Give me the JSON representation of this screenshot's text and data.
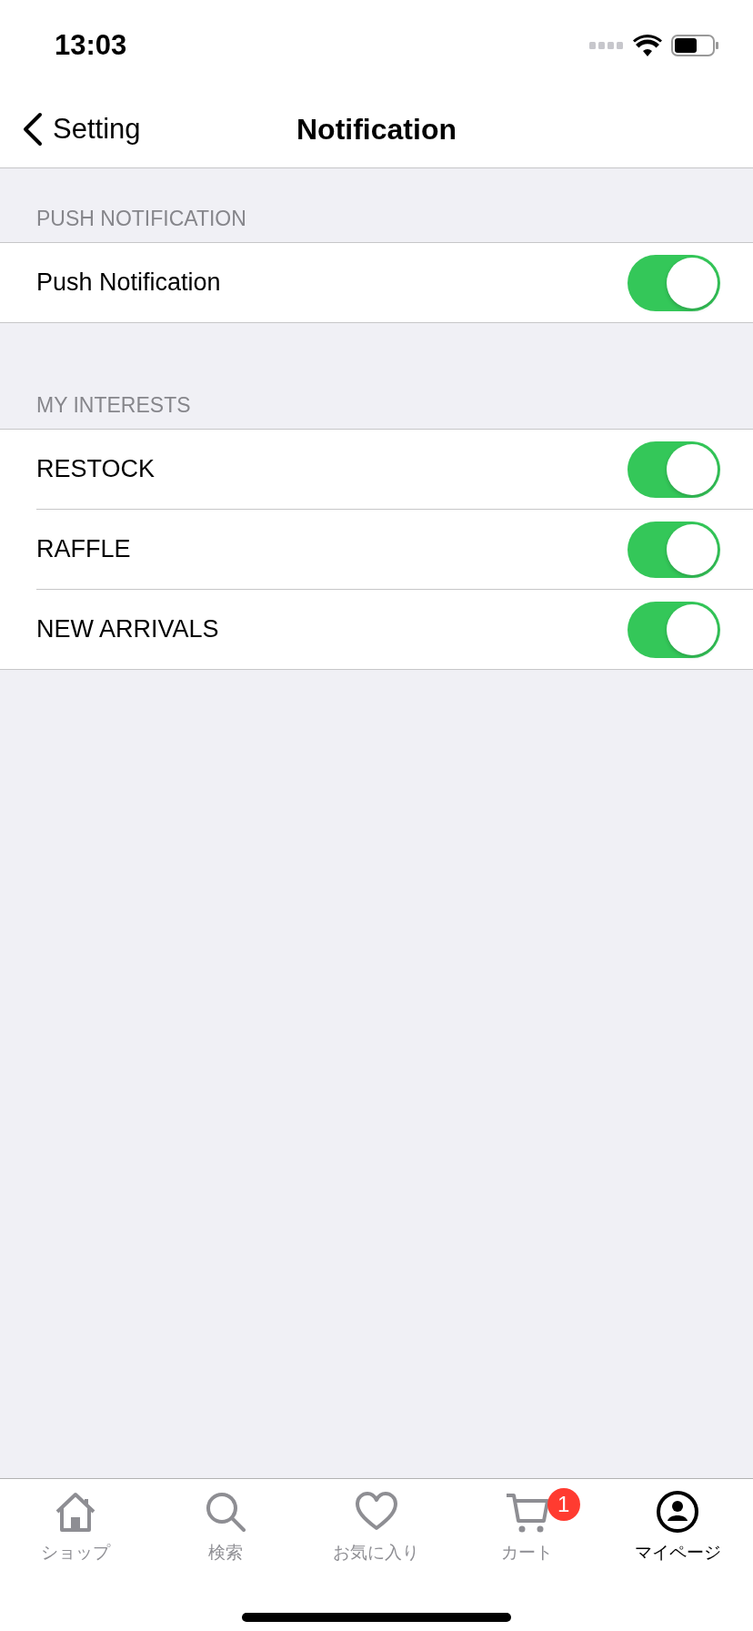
{
  "status_bar": {
    "time": "13:03"
  },
  "nav_bar": {
    "back_label": "Setting",
    "title": "Notification"
  },
  "sections": [
    {
      "header": "PUSH NOTIFICATION",
      "rows": [
        {
          "label": "Push Notification",
          "on": true
        }
      ]
    },
    {
      "header": "MY INTERESTS",
      "rows": [
        {
          "label": "RESTOCK",
          "on": true
        },
        {
          "label": "RAFFLE",
          "on": true
        },
        {
          "label": "NEW ARRIVALS",
          "on": true
        }
      ]
    }
  ],
  "tab_bar": {
    "items": [
      {
        "kind": "home",
        "label": "ショップ",
        "selected": false
      },
      {
        "kind": "search",
        "label": "検索",
        "selected": false
      },
      {
        "kind": "heart",
        "label": "お気に入り",
        "selected": false
      },
      {
        "kind": "cart",
        "label": "カート",
        "selected": false,
        "badge": "1"
      },
      {
        "kind": "person",
        "label": "マイページ",
        "selected": true
      }
    ]
  }
}
